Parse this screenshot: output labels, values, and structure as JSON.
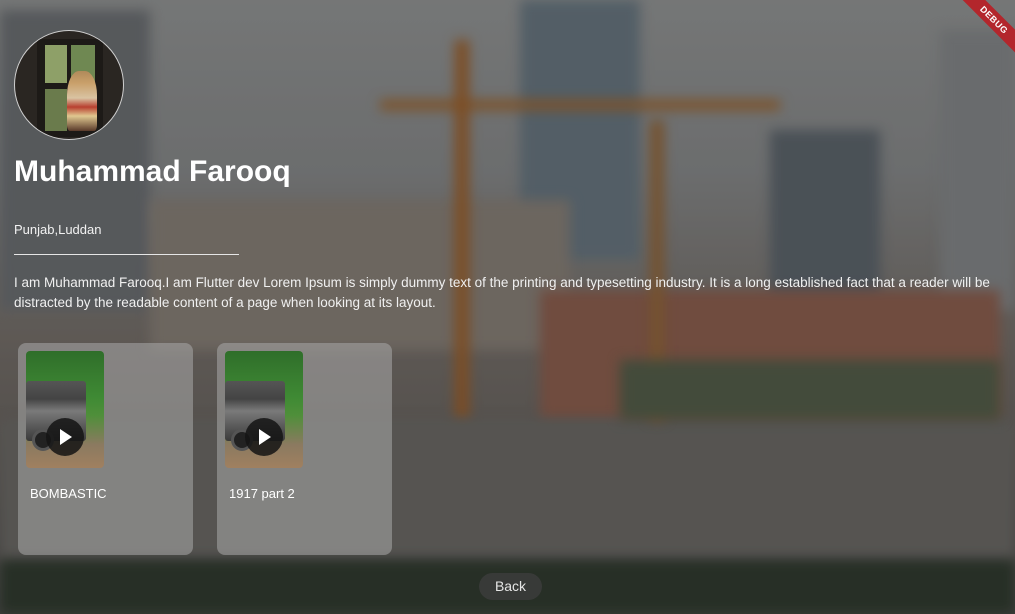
{
  "debug_banner": "DEBUG",
  "profile": {
    "name": "Muhammad Farooq",
    "location": "Punjab,Luddan",
    "bio": "I am Muhammad Farooq.I am Flutter dev  Lorem Ipsum is simply dummy text of the printing and typesetting industry.  It is a long established fact that a reader will be distracted by the readable content of a page when looking at its layout."
  },
  "videos": [
    {
      "title": "BOMBASTIC",
      "icon": "play-icon"
    },
    {
      "title": "1917 part 2",
      "icon": "play-icon"
    }
  ],
  "back_label": "Back"
}
